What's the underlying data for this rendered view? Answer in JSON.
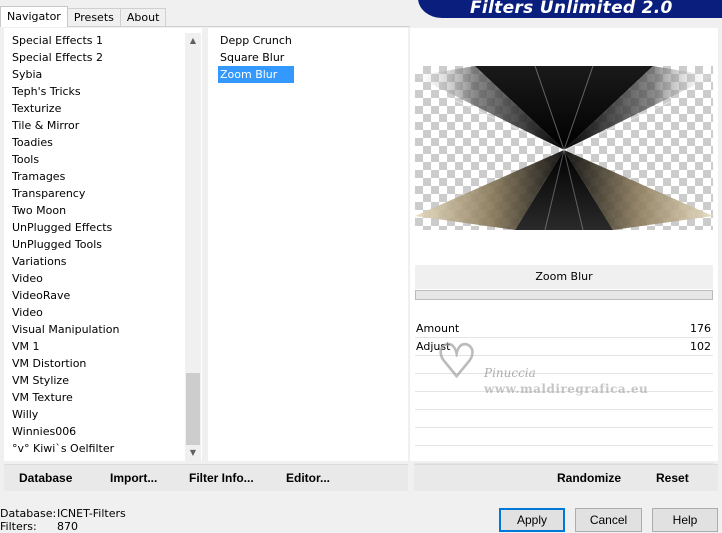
{
  "tabs": [
    {
      "label": "Navigator",
      "active": true
    },
    {
      "label": "Presets",
      "active": false
    },
    {
      "label": "About",
      "active": false
    }
  ],
  "banner": {
    "title": "Filters Unlimited 2.0",
    "color": "#0a1f7d"
  },
  "categories": [
    "Special Effects 1",
    "Special Effects 2",
    "Sybia",
    "Teph's Tricks",
    "Texturize",
    "Tile & Mirror",
    "Toadies",
    "Tools",
    "Tramages",
    "Transparency",
    "Two Moon",
    "UnPlugged Effects",
    "UnPlugged Tools",
    "Variations",
    "Video",
    "VideoRave",
    "Video",
    "Visual Manipulation",
    "VM 1",
    "VM Distortion",
    "VM Stylize",
    "VM Texture",
    "Willy",
    "Winnies006",
    "°v° Kiwi`s Oelfilter"
  ],
  "filters": [
    {
      "label": "Depp Crunch",
      "selected": false
    },
    {
      "label": "Square Blur",
      "selected": false
    },
    {
      "label": "Zoom Blur",
      "selected": true
    }
  ],
  "selected_filter": "Zoom Blur",
  "params": [
    {
      "label": "Amount",
      "value": "176"
    },
    {
      "label": "Adjust",
      "value": "102"
    }
  ],
  "watermark": {
    "name": "Pinuccia",
    "url": "www.maldiregrafica.eu"
  },
  "left_bar": {
    "database": "Database",
    "import": "Import...",
    "filter_info": "Filter Info...",
    "editor": "Editor..."
  },
  "right_bar": {
    "randomize": "Randomize",
    "reset": "Reset"
  },
  "status": {
    "database_label": "Database:",
    "database_value": "ICNET-Filters",
    "filters_label": "Filters:",
    "filters_value": "870"
  },
  "buttons": {
    "apply": "Apply",
    "cancel": "Cancel",
    "help": "Help"
  },
  "colors": {
    "selection": "#3399ff",
    "default_button_border": "#0078d7"
  }
}
